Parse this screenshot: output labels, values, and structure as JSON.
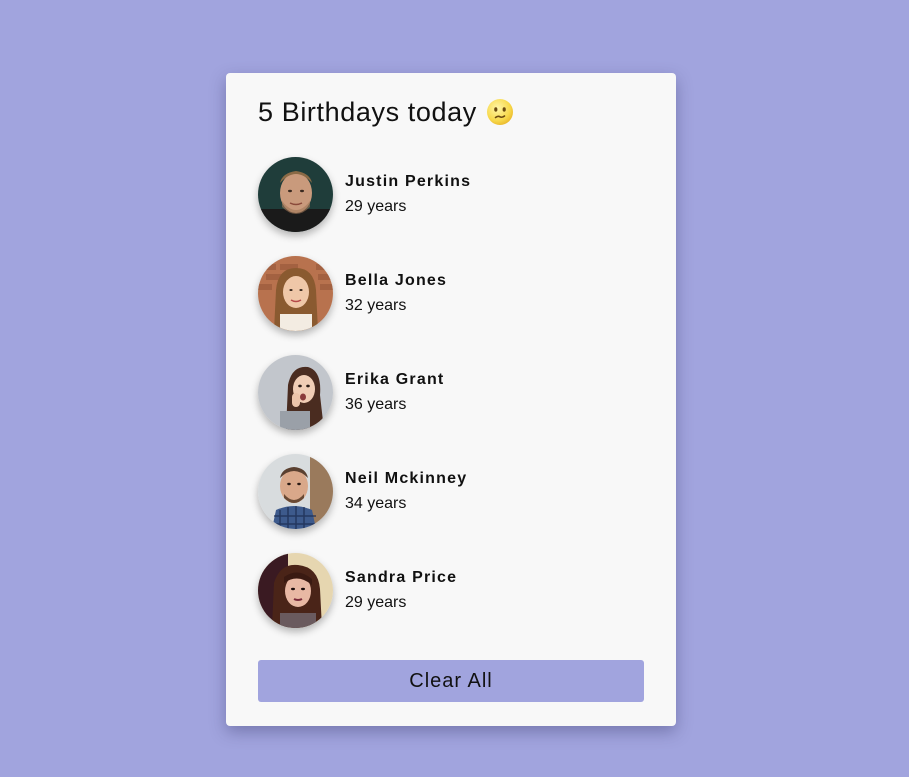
{
  "header": {
    "title": "5 Birthdays today",
    "emoji_icon": "confused-face-icon"
  },
  "people": [
    {
      "name": "Justin Perkins",
      "age": "29 years",
      "avatar_icon": "person-photo-icon"
    },
    {
      "name": "Bella Jones",
      "age": "32 years",
      "avatar_icon": "person-photo-icon"
    },
    {
      "name": "Erika Grant",
      "age": "36 years",
      "avatar_icon": "person-photo-icon"
    },
    {
      "name": "Neil Mckinney",
      "age": "34 years",
      "avatar_icon": "person-photo-icon"
    },
    {
      "name": "Sandra Price",
      "age": "29 years",
      "avatar_icon": "person-photo-icon"
    }
  ],
  "actions": {
    "clear_label": "Clear All"
  },
  "colors": {
    "background": "#a1a4de",
    "card": "#f8f8f8",
    "button": "#a1a4de"
  }
}
